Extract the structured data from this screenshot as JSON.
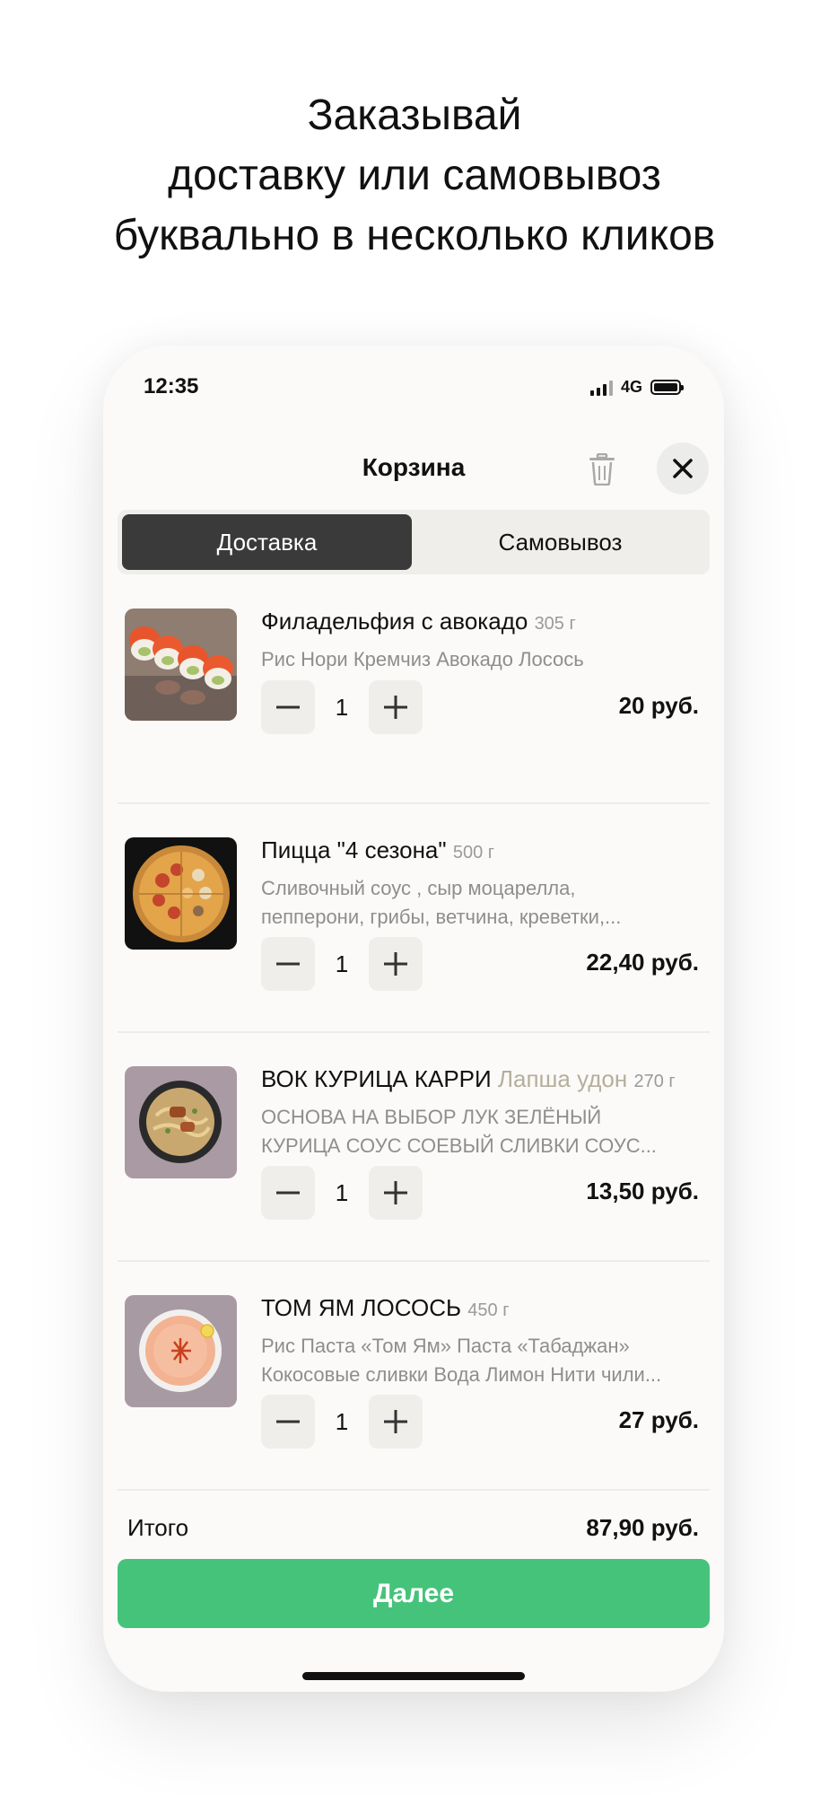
{
  "headline": {
    "line1": "Заказывай",
    "line2": "доставку или самовывоз",
    "line3": "буквально в несколько кликов"
  },
  "status_bar": {
    "time": "12:35",
    "network": "4G"
  },
  "header": {
    "title": "Корзина",
    "trash_icon": "trash-icon",
    "close_icon": "close-icon"
  },
  "tabs": [
    {
      "label": "Доставка",
      "active": true
    },
    {
      "label": "Самовывоз",
      "active": false
    }
  ],
  "items": [
    {
      "name": "Филадельфия с авокадо",
      "subtitle": "",
      "weight": "305 г",
      "description": [
        "Рис Нори Кремчиз Авокадо Лосось"
      ],
      "quantity": "1",
      "price": "20 руб."
    },
    {
      "name": "Пицца \"4 сезона\"",
      "subtitle": "",
      "weight": "500 г",
      "description": [
        "Сливочный соус , сыр моцарелла,",
        "пепперони, грибы, ветчина, креветки,..."
      ],
      "quantity": "1",
      "price": "22,40 руб."
    },
    {
      "name": "ВОК КУРИЦА КАРРИ",
      "subtitle": "Лапша удон",
      "weight": "270 г",
      "description": [
        "ОСНОВА НА ВЫБОР ЛУК ЗЕЛЁНЫЙ",
        "КУРИЦА СОУС СОЕВЫЙ СЛИВКИ СОУС..."
      ],
      "quantity": "1",
      "price": "13,50 руб."
    },
    {
      "name": "ТОМ ЯМ ЛОСОСЬ",
      "subtitle": "",
      "weight": "450 г",
      "description": [
        "Рис Паста «Том Ям» Паста «Табаджан»",
        "Кокосовые сливки Вода Лимон Нити чили..."
      ],
      "quantity": "1",
      "price": "27 руб."
    }
  ],
  "footer": {
    "total_label": "Итого",
    "total_value": "87,90 руб.",
    "next_label": "Далее"
  },
  "colors": {
    "accent": "#45c37a",
    "segment_active": "#3a3a3a",
    "muted": "#8e8e8e",
    "subtitle": "#b5ae9d"
  }
}
